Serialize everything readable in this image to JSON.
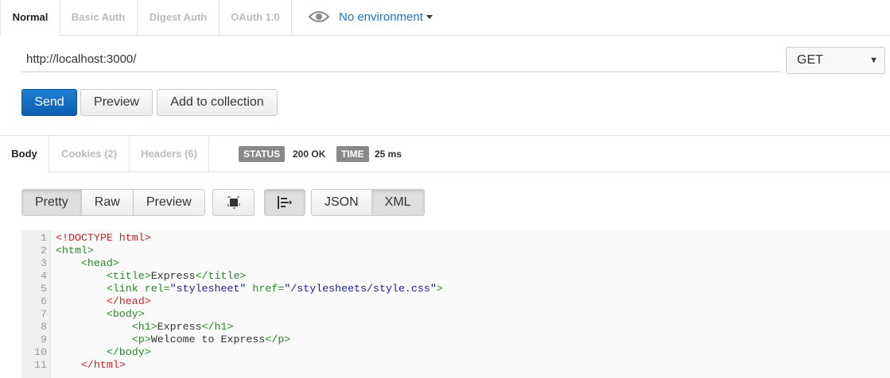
{
  "auth_tabs": [
    "Normal",
    "Basic Auth",
    "Digest Auth",
    "OAuth 1.0"
  ],
  "environment": {
    "label": "No environment",
    "icon": "eye-icon"
  },
  "request": {
    "url": "http://localhost:3000/",
    "method": "GET",
    "buttons": {
      "send": "Send",
      "preview": "Preview",
      "add": "Add to collection"
    }
  },
  "response": {
    "tabs": [
      "Body",
      "Cookies (2)",
      "Headers (6)"
    ],
    "status_label": "STATUS",
    "status_value": "200 OK",
    "time_label": "TIME",
    "time_value": "25 ms"
  },
  "viewer": {
    "modes": [
      "Pretty",
      "Raw",
      "Preview"
    ],
    "formats": [
      "JSON",
      "XML"
    ],
    "icons": [
      "fullscreen-icon",
      "wrap-lines-icon"
    ]
  },
  "code": {
    "line_numbers": [
      "1",
      "2",
      "3",
      "4",
      "5",
      "6",
      "7",
      "8",
      "9",
      "10",
      "11"
    ],
    "lines": [
      [
        {
          "t": "<!DOCTYPE html>",
          "c": "doctype"
        }
      ],
      [
        {
          "t": "<html>",
          "c": "tag"
        }
      ],
      [
        {
          "t": "    ",
          "c": "text"
        },
        {
          "t": "<head>",
          "c": "tag"
        }
      ],
      [
        {
          "t": "        ",
          "c": "text"
        },
        {
          "t": "<title>",
          "c": "tag"
        },
        {
          "t": "Express",
          "c": "text"
        },
        {
          "t": "</title>",
          "c": "tag"
        }
      ],
      [
        {
          "t": "        ",
          "c": "text"
        },
        {
          "t": "<link ",
          "c": "tag"
        },
        {
          "t": "rel=",
          "c": "attr"
        },
        {
          "t": "\"stylesheet\"",
          "c": "val"
        },
        {
          "t": " href=",
          "c": "attr"
        },
        {
          "t": "\"/stylesheets/style.css\"",
          "c": "val"
        },
        {
          "t": ">",
          "c": "tag"
        }
      ],
      [
        {
          "t": "        ",
          "c": "text"
        },
        {
          "t": "</head>",
          "c": "red"
        }
      ],
      [
        {
          "t": "        ",
          "c": "text"
        },
        {
          "t": "<body>",
          "c": "tag"
        }
      ],
      [
        {
          "t": "            ",
          "c": "text"
        },
        {
          "t": "<h1>",
          "c": "tag"
        },
        {
          "t": "Express",
          "c": "text"
        },
        {
          "t": "</h1>",
          "c": "tag"
        }
      ],
      [
        {
          "t": "            ",
          "c": "text"
        },
        {
          "t": "<p>",
          "c": "tag"
        },
        {
          "t": "Welcome to Express",
          "c": "text"
        },
        {
          "t": "</p>",
          "c": "tag"
        }
      ],
      [
        {
          "t": "        ",
          "c": "text"
        },
        {
          "t": "</body>",
          "c": "tag"
        }
      ],
      [
        {
          "t": "    ",
          "c": "text"
        },
        {
          "t": "</html>",
          "c": "red"
        }
      ]
    ]
  },
  "colors": {
    "accent": "#1a74c2",
    "send": "#0d5fb0",
    "badge": "#888888"
  }
}
